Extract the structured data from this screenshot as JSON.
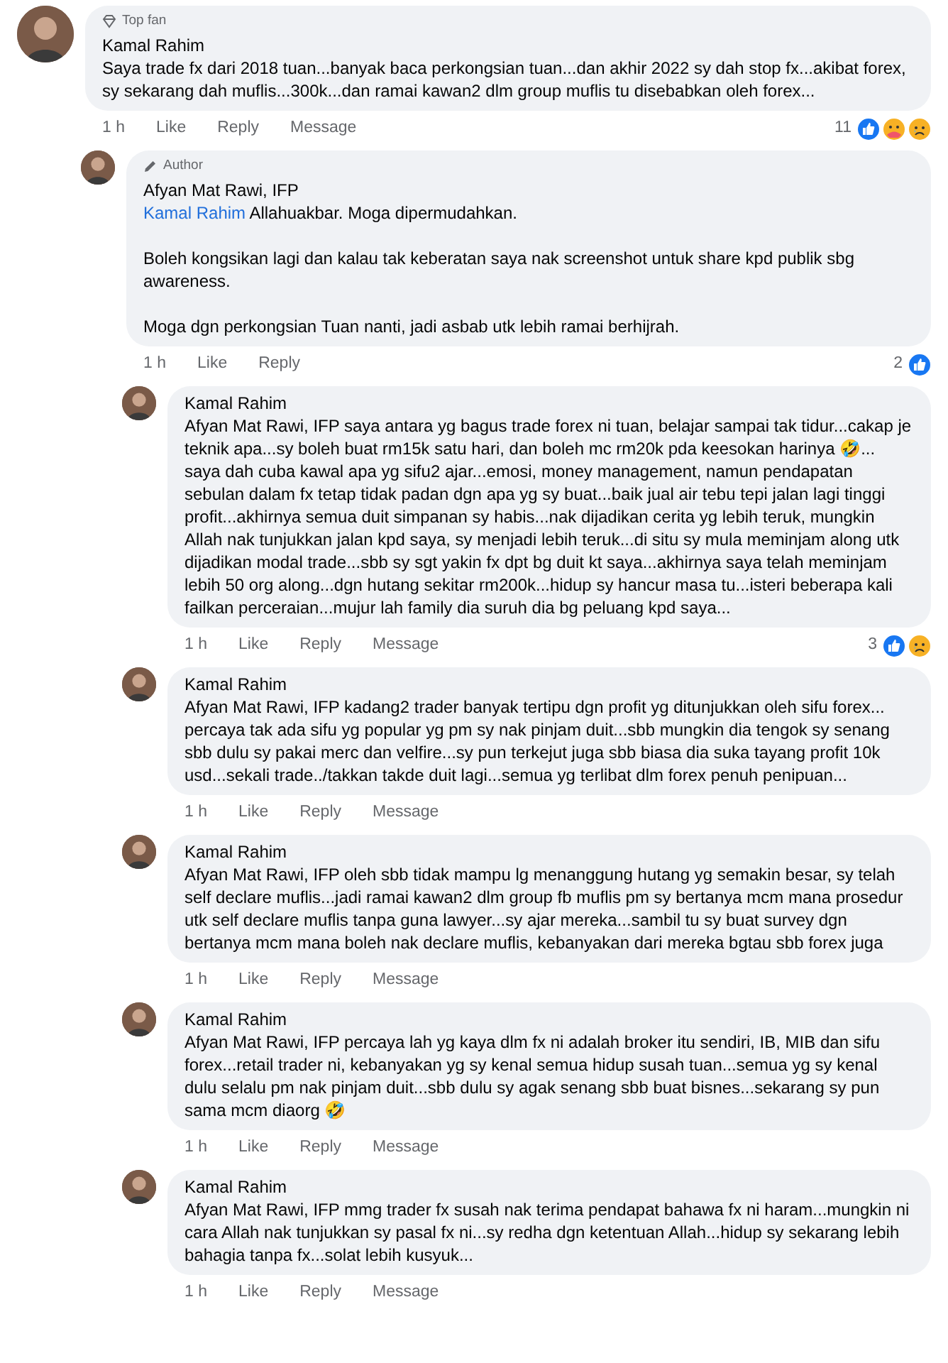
{
  "comments": [
    {
      "author": "Kamal Rahim",
      "badge": {
        "kind": "fan",
        "label": "Top fan"
      },
      "paragraphs": [
        "Saya trade fx dari 2018 tuan...banyak baca perkongsian tuan...dan akhir 2022 sy dah stop fx...akibat forex, sy sekarang dah muflis...300k...dan ramai kawan2 dlm group muflis tu disebabkan oleh forex..."
      ],
      "time": "1 h",
      "actions": [
        "Like",
        "Reply",
        "Message"
      ],
      "reaction_count": "11",
      "reactions": [
        {
          "kind": "like"
        },
        {
          "kind": "care"
        },
        {
          "kind": "sad"
        }
      ],
      "children": [
        {
          "author": "Afyan Mat Rawi, IFP",
          "badge": {
            "kind": "author",
            "label": "Author"
          },
          "mention": "Kamal Rahim",
          "paragraphs": [
            "Allahuakbar. Moga dipermudahkan.",
            "Boleh kongsikan lagi dan kalau tak keberatan saya nak screenshot untuk share kpd publik sbg awareness.",
            "Moga dgn  perkongsian Tuan nanti, jadi asbab utk lebih ramai berhijrah."
          ],
          "time": "1 h",
          "actions": [
            "Like",
            "Reply"
          ],
          "reaction_count": "2",
          "reactions": [
            {
              "kind": "like"
            }
          ],
          "children": [
            {
              "author": "Kamal Rahim",
              "paragraphs": [
                "Afyan Mat Rawi, IFP saya antara yg bagus trade forex ni tuan, belajar sampai tak tidur...cakap je teknik apa...sy boleh buat rm15k satu hari, dan boleh mc rm20k pda keesokan harinya 🤣... saya dah cuba kawal apa yg sifu2 ajar...emosi, money management, namun pendapatan sebulan dalam fx tetap tidak padan dgn apa yg sy buat...baik jual air tebu tepi jalan lagi tinggi profit...akhirnya semua duit simpanan sy habis...nak dijadikan cerita yg lebih teruk, mungkin Allah nak tunjukkan jalan kpd saya, sy menjadi lebih teruk...di situ sy mula meminjam along utk dijadikan modal trade...sbb sy sgt yakin fx dpt bg duit kt saya...akhirnya saya telah meminjam lebih 50 org along...dgn hutang sekitar rm200k...hidup sy hancur masa tu...isteri beberapa kali failkan perceraian...mujur lah family dia suruh dia bg peluang kpd saya..."
              ],
              "time": "1 h",
              "actions": [
                "Like",
                "Reply",
                "Message"
              ],
              "reaction_count": "3",
              "reactions": [
                {
                  "kind": "like"
                },
                {
                  "kind": "sad"
                }
              ]
            },
            {
              "author": "Kamal Rahim",
              "paragraphs": [
                "Afyan Mat Rawi, IFP kadang2 trader banyak tertipu dgn profit yg ditunjukkan oleh sifu forex... percaya tak ada sifu yg popular yg pm sy nak pinjam duit...sbb mungkin dia tengok sy senang sbb dulu sy pakai merc dan velfire...sy pun terkejut juga sbb biasa dia suka tayang profit 10k usd...sekali trade../takkan takde duit lagi...semua yg terlibat dlm forex penuh penipuan..."
              ],
              "time": "1 h",
              "actions": [
                "Like",
                "Reply",
                "Message"
              ]
            },
            {
              "author": "Kamal Rahim",
              "paragraphs": [
                "Afyan Mat Rawi, IFP oleh sbb tidak mampu lg menanggung hutang yg semakin besar, sy telah self declare muflis...jadi ramai kawan2 dlm group fb muflis pm sy bertanya mcm mana prosedur utk self declare muflis tanpa guna lawyer...sy ajar mereka...sambil tu sy buat survey dgn bertanya mcm mana boleh nak declare muflis, kebanyakan dari mereka bgtau sbb forex juga"
              ],
              "time": "1 h",
              "actions": [
                "Like",
                "Reply",
                "Message"
              ]
            },
            {
              "author": "Kamal Rahim",
              "paragraphs": [
                "Afyan Mat Rawi, IFP percaya lah yg kaya dlm fx ni adalah broker itu sendiri, IB, MIB dan sifu forex...retail trader ni, kebanyakan yg sy kenal semua hidup susah tuan...semua yg sy kenal dulu selalu pm nak pinjam duit...sbb dulu sy agak senang sbb buat bisnes...sekarang sy pun sama mcm diaorg 🤣"
              ],
              "time": "1 h",
              "actions": [
                "Like",
                "Reply",
                "Message"
              ]
            },
            {
              "author": "Kamal Rahim",
              "paragraphs": [
                "Afyan Mat Rawi, IFP mmg trader fx susah nak terima pendapat bahawa fx ni haram...mungkin ni cara Allah nak tunjukkan sy pasal fx ni...sy redha dgn ketentuan Allah...hidup sy sekarang lebih bahagia tanpa fx...solat lebih kusyuk..."
              ],
              "time": "1 h",
              "actions": [
                "Like",
                "Reply",
                "Message"
              ]
            }
          ]
        }
      ]
    }
  ]
}
